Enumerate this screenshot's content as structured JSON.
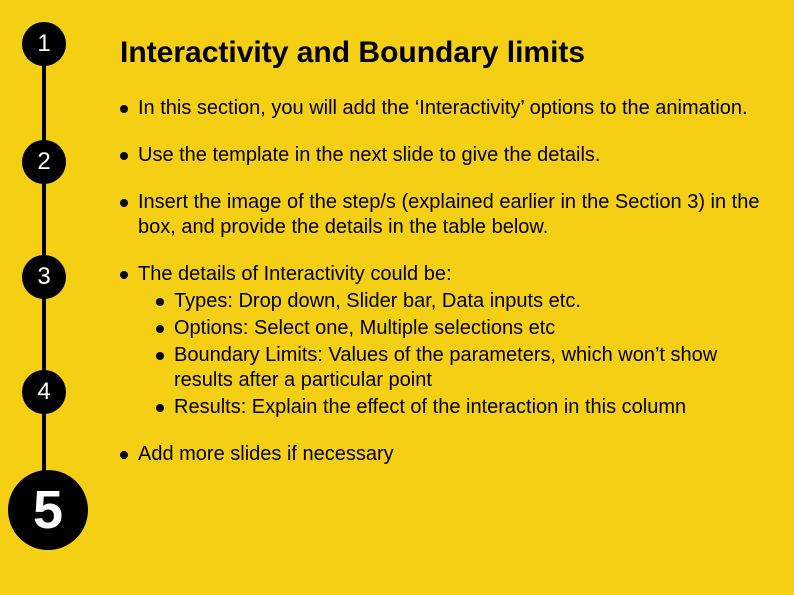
{
  "nav": {
    "steps": [
      "1",
      "2",
      "3",
      "4",
      "5"
    ],
    "active": "5"
  },
  "title": "Interactivity and Boundary limits",
  "bullets": {
    "b1": "In this section, you will add the ‘Interactivity’ options to the animation.",
    "b2": "Use the template in the next slide to give the details.",
    "b3": "Insert the image of the step/s (explained earlier in the Section 3) in the box, and provide the details in the table below.",
    "b4": {
      "lead": "The details of Interactivity could be:",
      "sub1": "Types: Drop down, Slider bar, Data inputs etc.",
      "sub2": "Options: Select one, Multiple selections etc",
      "sub3": "Boundary Limits: Values of the parameters, which won’t show results after a particular point",
      "sub4": "Results: Explain the effect of the interaction in this column"
    },
    "b5": "Add more slides if necessary"
  }
}
